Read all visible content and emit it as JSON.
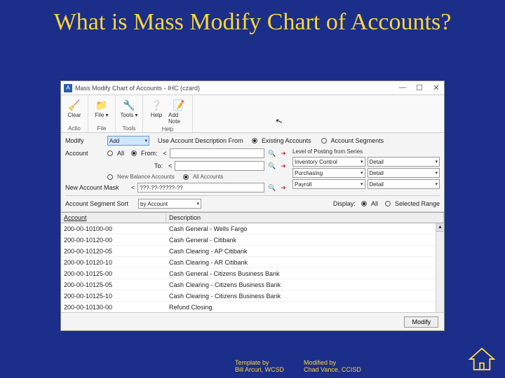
{
  "slide": {
    "title": "What is Mass Modify Chart of Accounts?"
  },
  "window": {
    "app_icon_letter": "A",
    "title": "Mass Modify Chart of Accounts - IHC (czard)",
    "controls": {
      "min": "—",
      "max": "☐",
      "close": "✕"
    }
  },
  "ribbon": {
    "groups": [
      {
        "label": "Actio",
        "buttons": [
          {
            "name": "clear-btn",
            "icon": "🧹",
            "text": "Clear"
          }
        ]
      },
      {
        "label": "File",
        "buttons": [
          {
            "name": "file-btn",
            "icon": "📁",
            "text": "File ▾"
          }
        ]
      },
      {
        "label": "Tools",
        "buttons": [
          {
            "name": "tools-btn",
            "icon": "🔧",
            "text": "Tools ▾"
          }
        ]
      },
      {
        "label": "Help",
        "buttons": [
          {
            "name": "help-btn",
            "icon": "❔",
            "text": "Help"
          },
          {
            "name": "add-note-btn",
            "icon": "📝",
            "text": "Add Note"
          }
        ]
      }
    ]
  },
  "form": {
    "modify_label": "Modify",
    "modify_value": "Add",
    "use_desc_label": "Use Account Description From",
    "opt_existing": "Existing Accounts",
    "opt_segments": "Account Segments",
    "account_label": "Account",
    "all_label": "All",
    "from_label": "From:",
    "to_label": "To:",
    "restrict_new": "New Balance Accounts",
    "restrict_all": "All Accounts",
    "mask_label": "New Account Mask",
    "mask_value": "???-??-?????-??",
    "sort_label": "Account Segment Sort",
    "sort_value": "by Account",
    "display_label": "Display:",
    "display_all": "All",
    "display_sel": "Selected Range"
  },
  "posting": {
    "title": "Level of Posting from Series",
    "rows": [
      {
        "name": "Inventory Control",
        "value": "Detail"
      },
      {
        "name": "Purchasing",
        "value": "Detail"
      },
      {
        "name": "Payroll",
        "value": "Detail"
      }
    ]
  },
  "table": {
    "headers": {
      "acct": "Account",
      "desc": "Description"
    },
    "rows": [
      {
        "acct": "200-00-10100-00",
        "desc": "Cash General - Wells Fargo"
      },
      {
        "acct": "200-00-10120-00",
        "desc": "Cash General - Citibank"
      },
      {
        "acct": "200-00-10120-05",
        "desc": "Cash Clearing - AP Citibank"
      },
      {
        "acct": "200-00-10120-10",
        "desc": "Cash Clearing - AR Citibank"
      },
      {
        "acct": "200-00-10125-00",
        "desc": "Cash General - Citizens Business Bank"
      },
      {
        "acct": "200-00-10125-05",
        "desc": "Cash Clearing - Citizens Business Bank"
      },
      {
        "acct": "200-00-10125-10",
        "desc": "Cash Clearing - Citizens Business Bank"
      },
      {
        "acct": "200-00-10130-00",
        "desc": "Refund Closing"
      }
    ]
  },
  "footer": {
    "modify_btn": "Modify"
  },
  "credits": {
    "left_label": "Template by",
    "left_name": "Bill Arcuri, WCSD",
    "right_label": "Modified by",
    "right_name": "Chad Vance, CCISD"
  }
}
